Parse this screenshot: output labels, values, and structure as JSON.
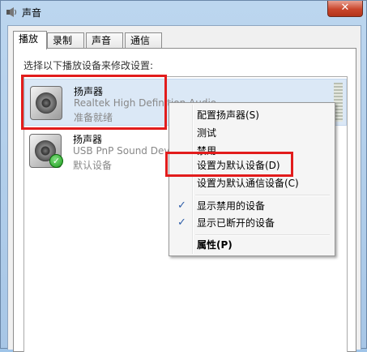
{
  "window": {
    "title": "声音",
    "close_glyph": "✕"
  },
  "tabs": [
    {
      "label": "播放",
      "active": true
    },
    {
      "label": "录制",
      "active": false
    },
    {
      "label": "声音",
      "active": false
    },
    {
      "label": "通信",
      "active": false
    }
  ],
  "instruction": "选择以下播放设备来修改设置:",
  "devices": [
    {
      "name": "扬声器",
      "description": "Realtek High Definition Audio",
      "status": "准备就绪",
      "selected": true,
      "default": false,
      "icon": "speaker-icon"
    },
    {
      "name": "扬声器",
      "description": "USB PnP Sound Device",
      "status": "默认设备",
      "selected": false,
      "default": true,
      "icon": "speaker-icon"
    }
  ],
  "context_menu": {
    "items": [
      {
        "label": "配置扬声器(S)"
      },
      {
        "label": "测试"
      },
      {
        "label": "禁用"
      },
      {
        "label": "设置为默认设备(D)"
      },
      {
        "label": "设置为默认通信设备(C)"
      },
      {
        "label": "显示禁用的设备",
        "checked": true
      },
      {
        "label": "显示已断开的设备",
        "checked": true
      },
      {
        "label": "属性(P)",
        "bold": true
      }
    ],
    "check_glyph": "✓"
  },
  "highlight_color": "#e21c1c"
}
